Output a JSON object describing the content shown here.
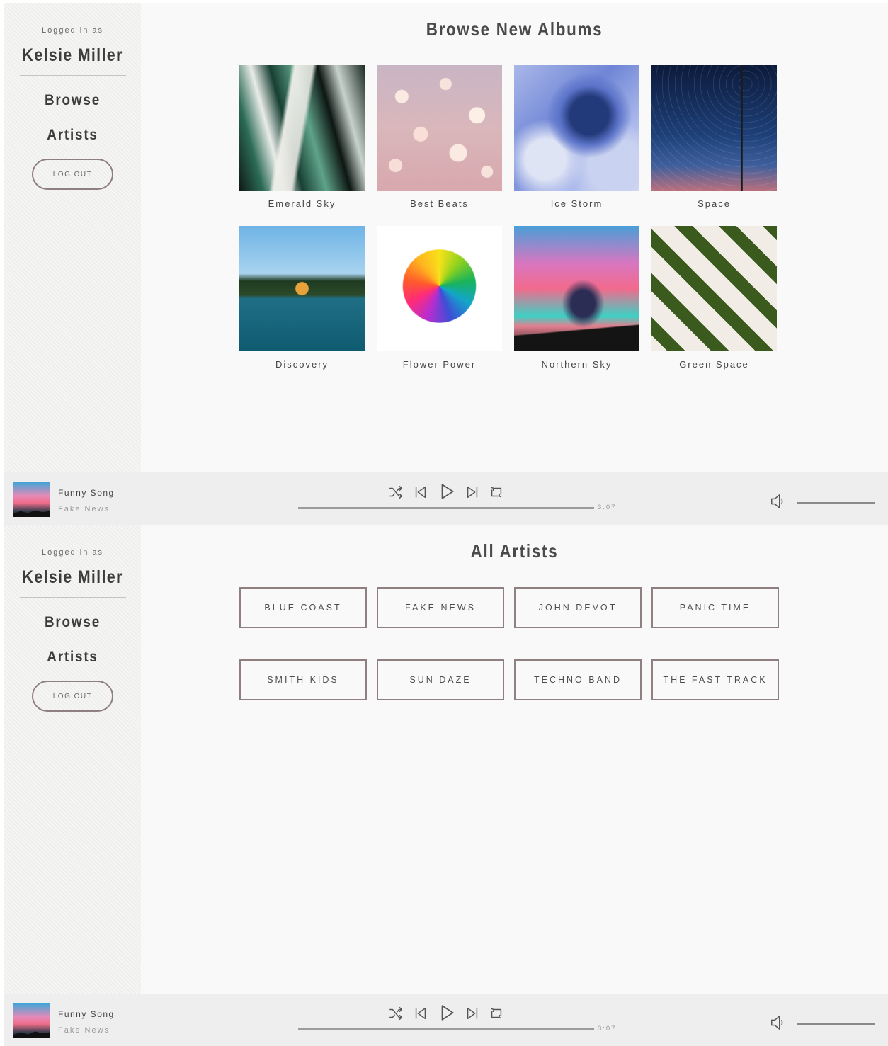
{
  "sidebar": {
    "logged_in_label": "Logged in as",
    "user_name": "Kelsie Miller",
    "nav": {
      "browse": "Browse",
      "artists": "Artists"
    },
    "logout_label": "LOG OUT"
  },
  "browse_page": {
    "title": "Browse New Albums",
    "albums": [
      {
        "title": "Emerald Sky"
      },
      {
        "title": "Best Beats"
      },
      {
        "title": "Ice Storm"
      },
      {
        "title": "Space"
      },
      {
        "title": "Discovery"
      },
      {
        "title": "Flower Power"
      },
      {
        "title": "Northern Sky"
      },
      {
        "title": "Green Space"
      }
    ]
  },
  "artists_page": {
    "title": "All Artists",
    "artists": [
      "BLUE COAST",
      "FAKE NEWS",
      "JOHN DEVOT",
      "PANIC TIME",
      "SMITH KIDS",
      "SUN DAZE",
      "TECHNO BAND",
      "THE FAST TRACK"
    ]
  },
  "player": {
    "song_title": "Funny Song",
    "song_artist": "Fake News",
    "duration": "3:07",
    "icons": [
      "shuffle-icon",
      "previous-icon",
      "play-icon",
      "next-icon",
      "repeat-icon",
      "volume-icon"
    ]
  },
  "colors": {
    "sidebar_bg": "#f1f1f0",
    "main_bg": "#f9f9f9",
    "player_bg": "#eeeeee",
    "accent_border": "#8f7f81"
  }
}
